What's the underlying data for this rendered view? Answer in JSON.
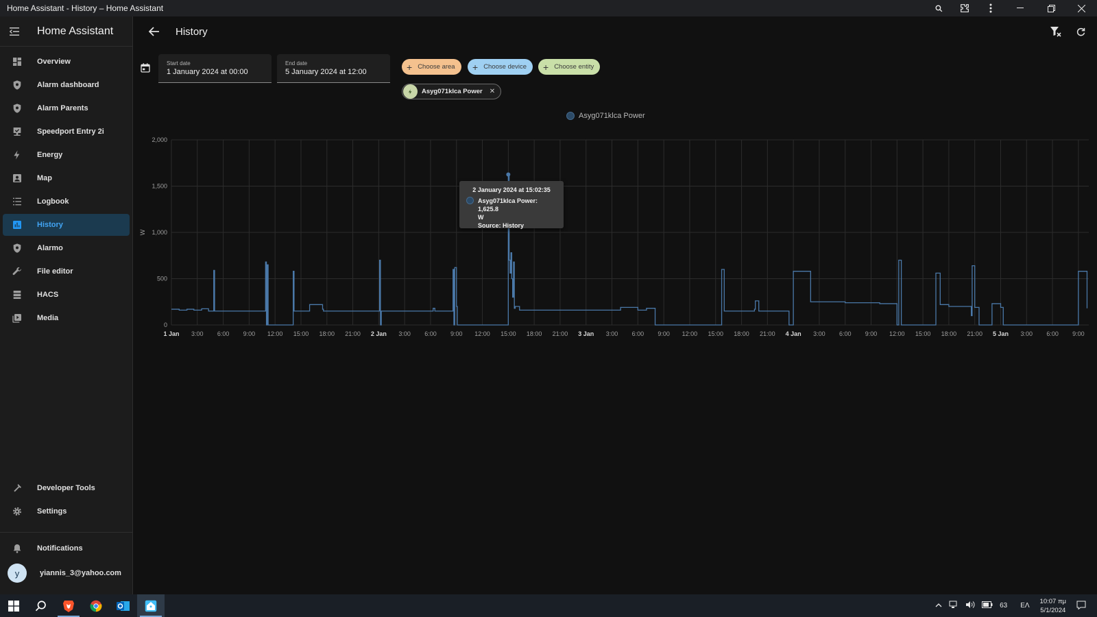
{
  "window": {
    "title": "Home Assistant - History – Home Assistant"
  },
  "sidebar": {
    "app_title": "Home Assistant",
    "items": [
      {
        "label": "Overview",
        "icon": "view-dashboard-icon"
      },
      {
        "label": "Alarm dashboard",
        "icon": "shield-icon"
      },
      {
        "label": "Alarm Parents",
        "icon": "shield-icon"
      },
      {
        "label": "Speedport Entry 2i",
        "icon": "router-icon"
      },
      {
        "label": "Energy",
        "icon": "lightning-bolt-icon"
      },
      {
        "label": "Map",
        "icon": "map-icon"
      },
      {
        "label": "Logbook",
        "icon": "format-list-icon"
      },
      {
        "label": "History",
        "icon": "chart-box-icon",
        "active": true
      },
      {
        "label": "Alarmo",
        "icon": "shield-icon"
      },
      {
        "label": "File editor",
        "icon": "wrench-icon"
      },
      {
        "label": "HACS",
        "icon": "hacs-icon"
      },
      {
        "label": "Media",
        "icon": "play-box-icon"
      }
    ],
    "developer_tools": "Developer Tools",
    "settings": "Settings",
    "notifications": "Notifications",
    "user": {
      "initial": "y",
      "name": "yiannis_3@yahoo.com"
    }
  },
  "toolbar": {
    "title": "History"
  },
  "date_range": {
    "start_label": "Start date",
    "start_value": "1 January 2024 at 00:00",
    "end_label": "End date",
    "end_value": "5 January 2024 at 12:00"
  },
  "chips": {
    "area": "Choose area",
    "device": "Choose device",
    "entity": "Choose entity",
    "selected_entity": "Asyg071klca Power"
  },
  "colors": {
    "accent": "#2196f3",
    "series": "#4a78a8",
    "chip_area": "#f4c18e",
    "chip_device": "#9fd0f2",
    "chip_entity": "#c9dfa8"
  },
  "tooltip": {
    "title": "2 January 2024 at 15:02:35",
    "line1": "Asyg071klca Power: 1,625.8",
    "line2": "W",
    "source": "Source: History"
  },
  "chart_data": {
    "type": "line",
    "ylabel": "W",
    "ylim": [
      0,
      2000
    ],
    "yticks": [
      "0",
      "500",
      "1,000",
      "1,500",
      "2,000"
    ],
    "xticks": [
      "1 Jan",
      "3:00",
      "6:00",
      "9:00",
      "12:00",
      "15:00",
      "18:00",
      "21:00",
      "2 Jan",
      "3:00",
      "6:00",
      "9:00",
      "12:00",
      "15:00",
      "18:00",
      "21:00",
      "3 Jan",
      "3:00",
      "6:00",
      "9:00",
      "12:00",
      "15:00",
      "18:00",
      "21:00",
      "4 Jan",
      "3:00",
      "6:00",
      "9:00",
      "12:00",
      "15:00",
      "18:00",
      "21:00",
      "5 Jan",
      "3:00",
      "6:00",
      "9:00"
    ],
    "xrange_hours": [
      0,
      106.2
    ],
    "series": [
      {
        "name": "Asyg071klca Power",
        "x_hours": [
          0,
          0.8,
          0.9,
          1.7,
          1.8,
          2.5,
          2.6,
          3.4,
          3.5,
          4.2,
          4.3,
          4.8,
          4.9,
          5.0,
          5.1,
          5.6,
          7.0,
          8.0,
          9.0,
          10.0,
          10.8,
          10.9,
          11.0,
          11.1,
          11.2,
          11.3,
          11.4,
          11.5,
          12.0,
          12.5,
          13.0,
          14.0,
          14.1,
          14.2,
          14.3,
          15.0,
          16.0,
          17.0,
          17.5,
          17.6,
          18.0,
          18.5,
          19.0,
          20.0,
          22.0,
          23.0,
          24.0,
          24.1,
          24.2,
          24.3,
          26.0,
          28.0,
          30.0,
          30.3,
          30.5,
          32.5,
          32.6,
          32.7,
          32.8,
          33.0,
          33.1,
          33.2,
          33.5,
          36.0,
          38.0,
          38.9,
          39.0,
          39.1,
          39.2,
          39.3,
          39.4,
          39.5,
          39.6,
          39.7,
          39.8,
          40.2,
          40.3,
          40.5,
          41.0,
          42.0,
          44.0,
          46.0,
          48.0,
          50.0,
          52.0,
          54.0,
          55.0,
          56.0,
          57.5,
          57.6,
          60.0,
          62.0,
          63.0,
          63.5,
          63.6,
          63.7,
          64.0,
          66.0,
          67.0,
          67.5,
          67.6,
          68.0,
          71.5,
          71.6,
          71.7,
          72.0,
          74.0,
          76.0,
          78.0,
          80.0,
          81.0,
          82.0,
          83.0,
          83.5,
          84.0,
          84.1,
          84.2,
          84.5,
          85.0,
          86.0,
          87.0,
          88.0,
          88.3,
          88.4,
          88.5,
          89.0,
          90.0,
          91.0,
          92.0,
          92.6,
          92.7,
          93.0,
          93.5,
          94.0,
          95.0,
          96.0,
          96.1,
          96.2,
          96.3,
          98.0,
          100.0,
          102.0,
          104.0,
          105.0,
          106.0
        ],
        "values": [
          170,
          170,
          160,
          160,
          170,
          170,
          160,
          160,
          175,
          175,
          150,
          150,
          590,
          150,
          150,
          150,
          150,
          150,
          150,
          150,
          150,
          680,
          0,
          650,
          0,
          0,
          0,
          0,
          0,
          0,
          0,
          0,
          580,
          150,
          150,
          150,
          220,
          220,
          170,
          150,
          150,
          150,
          150,
          150,
          150,
          150,
          150,
          700,
          0,
          150,
          150,
          150,
          150,
          180,
          150,
          150,
          600,
          0,
          620,
          200,
          0,
          0,
          0,
          0,
          0,
          0,
          1625.8,
          700,
          560,
          780,
          500,
          300,
          680,
          180,
          200,
          200,
          160,
          160,
          160,
          160,
          160,
          160,
          160,
          160,
          190,
          160,
          180,
          0,
          0,
          0,
          0,
          0,
          0,
          0,
          0,
          600,
          150,
          150,
          150,
          170,
          260,
          150,
          0,
          0,
          0,
          580,
          250,
          250,
          240,
          240,
          240,
          230,
          230,
          230,
          0,
          0,
          700,
          0,
          0,
          0,
          0,
          0,
          0,
          0,
          560,
          220,
          200,
          200,
          200,
          100,
          640,
          190,
          0,
          0,
          230,
          190,
          190,
          190,
          0,
          0,
          0,
          0,
          0,
          580,
          180,
          180,
          180,
          180,
          210,
          180,
          200
        ]
      }
    ]
  }
}
